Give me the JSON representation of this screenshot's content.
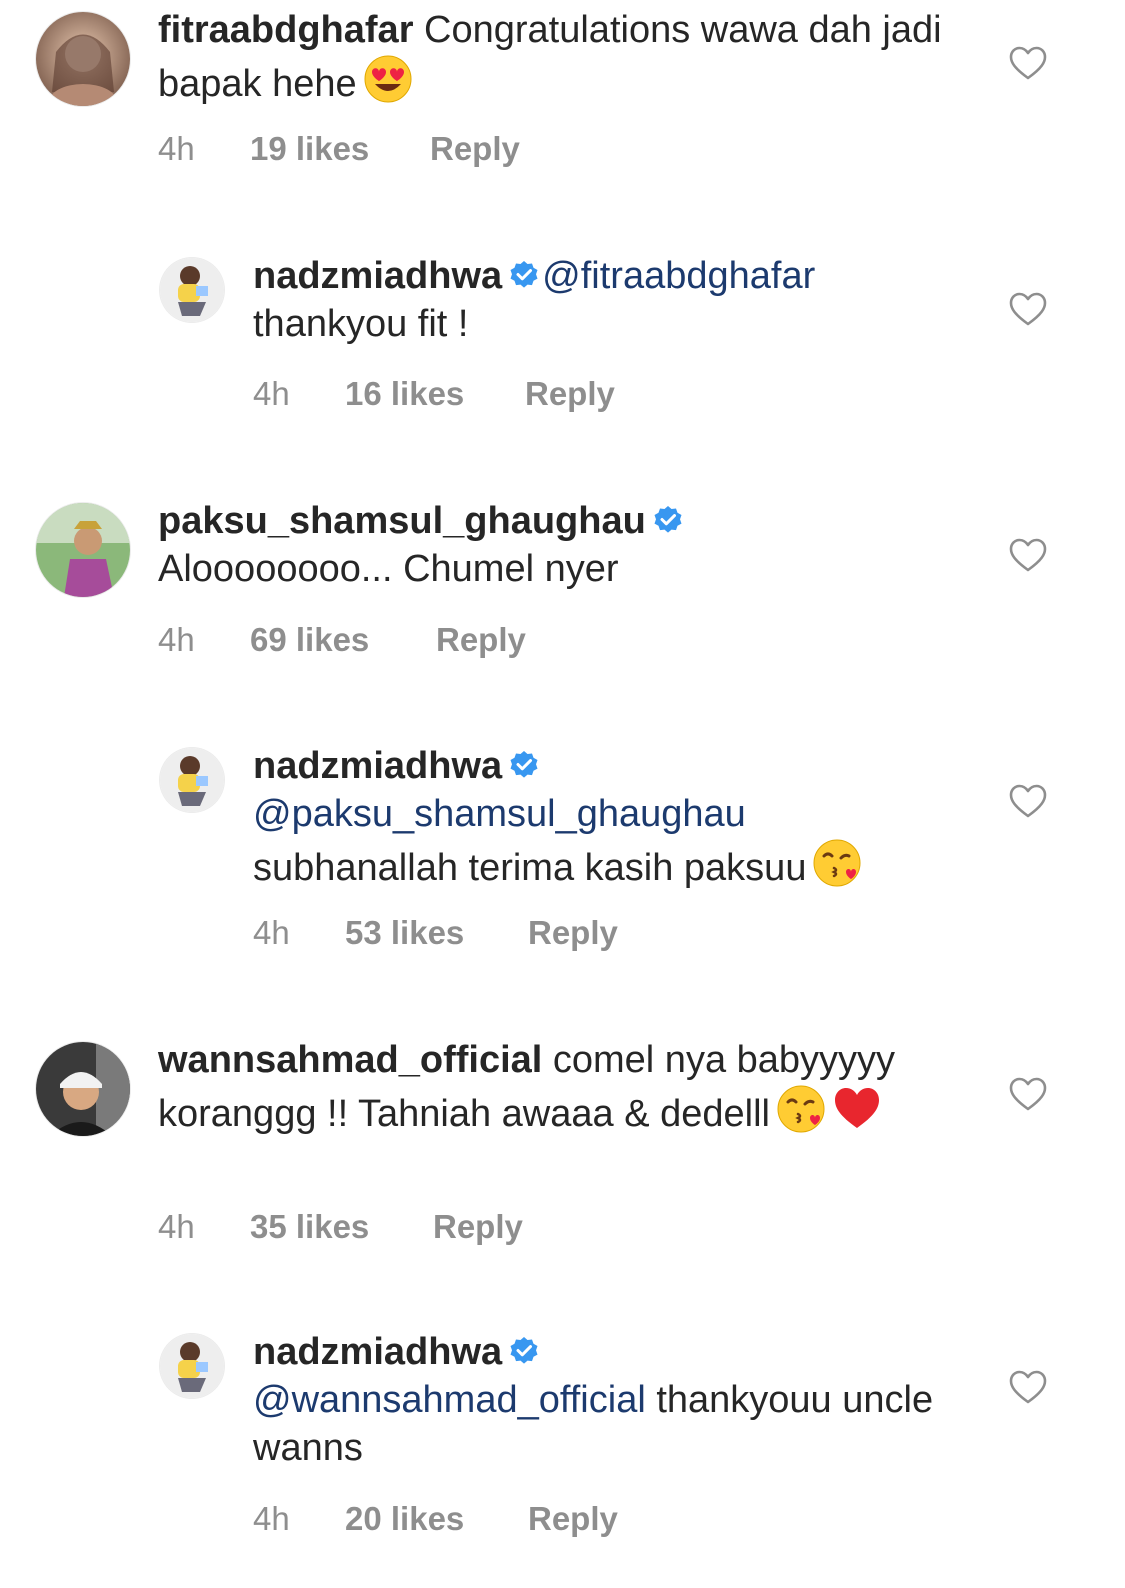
{
  "comments": [
    {
      "username": "fitraabdghafar",
      "text": " Congratulations wawa dah jadi bapak hehe",
      "emoji": [
        "heart-eyes"
      ],
      "time": "4h",
      "likes": "19 likes",
      "reply_label": "Reply"
    },
    {
      "username": "nadzmiadhwa",
      "verified": true,
      "mention": "@fitraabdghafar",
      "text": "thankyou fit !",
      "time": "4h",
      "likes": "16 likes",
      "reply_label": "Reply"
    },
    {
      "username": "paksu_shamsul_ghaughau",
      "verified": true,
      "text": "Aloooooooo... Chumel nyer",
      "time": "4h",
      "likes": "69 likes",
      "reply_label": "Reply"
    },
    {
      "username": "nadzmiadhwa",
      "verified": true,
      "mention": "@paksu_shamsul_ghaughau",
      "text": "subhanallah terima kasih paksuu",
      "emoji": [
        "kissing-heart"
      ],
      "time": "4h",
      "likes": "53 likes",
      "reply_label": "Reply"
    },
    {
      "username": "wannsahmad_official",
      "text": " comel nya babyyyyy koranggg !! Tahniah awaaa & dedelll",
      "emoji": [
        "kissing-heart",
        "red-heart"
      ],
      "time": "4h",
      "likes": "35 likes",
      "reply_label": "Reply"
    },
    {
      "username": "nadzmiadhwa",
      "verified": true,
      "mention": "@wannsahmad_official",
      "text": " thankyouu uncle wanns",
      "time": "4h",
      "likes": "20 likes",
      "reply_label": "Reply"
    }
  ],
  "icons": {
    "like": "heart-outline-icon",
    "verified": "verified-badge-icon"
  },
  "colors": {
    "text": "#262626",
    "meta": "#8e8e8e",
    "mention": "#1c3a6e",
    "verified": "#3897f0"
  }
}
